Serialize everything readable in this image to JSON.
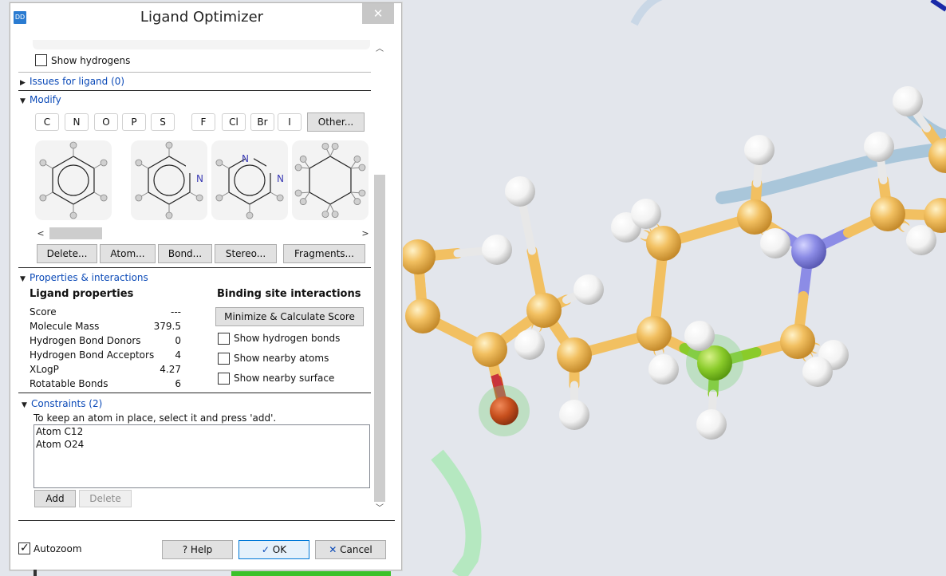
{
  "dialog": {
    "title": "Ligand Optimizer",
    "app_icon": "DD",
    "close_glyph": "✕"
  },
  "show_hydrogens": {
    "label": "Show hydrogens",
    "checked": false
  },
  "sections": {
    "issues": "Issues for ligand (0)",
    "modify": "Modify",
    "properties": "Properties & interactions",
    "constraints": "Constraints (2)"
  },
  "elements": [
    "C",
    "N",
    "O",
    "P",
    "S",
    "F",
    "Cl",
    "Br",
    "I"
  ],
  "other_button": "Other...",
  "fragments": [
    {
      "name": "benzene",
      "label": ""
    },
    {
      "name": "pyridine",
      "label": "N"
    },
    {
      "name": "pyrimidine",
      "label": "N"
    },
    {
      "name": "cyclohexane",
      "label": ""
    }
  ],
  "modify_buttons": {
    "delete": "Delete...",
    "atom": "Atom...",
    "bond": "Bond...",
    "stereo": "Stereo...",
    "fragments": "Fragments..."
  },
  "ligand_properties": {
    "heading": "Ligand properties",
    "rows": [
      {
        "label": "Score",
        "value": "---"
      },
      {
        "label": "Molecule Mass",
        "value": "379.5"
      },
      {
        "label": "Hydrogen Bond Donors",
        "value": "0"
      },
      {
        "label": "Hydrogen Bond Acceptors",
        "value": "4"
      },
      {
        "label": "XLogP",
        "value": "4.27"
      },
      {
        "label": "Rotatable Bonds",
        "value": "6"
      }
    ]
  },
  "binding_site": {
    "heading": "Binding site interactions",
    "minimize_button": "Minimize & Calculate Score",
    "options": [
      {
        "label": "Show hydrogen bonds",
        "checked": false
      },
      {
        "label": "Show nearby atoms",
        "checked": false
      },
      {
        "label": "Show nearby surface",
        "checked": false
      }
    ]
  },
  "constraints": {
    "hint": "To keep an atom in place, select it and press 'add'.",
    "items": [
      "Atom C12",
      "Atom O24"
    ],
    "add_button": "Add",
    "delete_button": "Delete"
  },
  "footer": {
    "autozoom": {
      "label": "Autozoom",
      "checked": true
    },
    "help": "Help",
    "ok": "OK",
    "cancel": "Cancel"
  },
  "colors": {
    "section_link": "#0a49b7",
    "carbon": "#f2c061",
    "hydrogen": "#ffffff",
    "nitrogen": "#8c8ce6",
    "oxygen": "#d2451e",
    "fluorine": "#8acb2a",
    "viewer_background": "#e3e6ec"
  }
}
